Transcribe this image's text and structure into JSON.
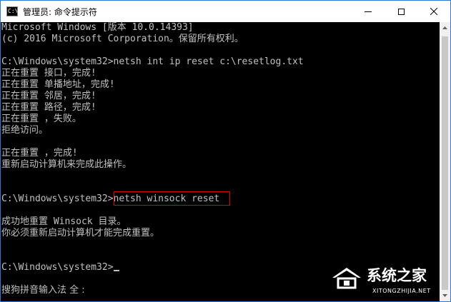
{
  "window": {
    "title": "管理员: 命令提示符",
    "icon_text": "C:\\"
  },
  "console": {
    "lines": [
      "Microsoft Windows [版本 10.0.14393]",
      "(c) 2016 Microsoft Corporation。保留所有权利。",
      "",
      "C:\\Windows\\system32>netsh int ip reset c:\\resetlog.txt",
      "正在重置 接口，完成!",
      "正在重置 单播地址，完成!",
      "正在重置 邻居，完成!",
      "正在重置 路径，完成!",
      "正在重置 ，失败。",
      "拒绝访问。",
      "",
      "正在重置 ，完成!",
      "重新启动计算机来完成此操作。",
      "",
      "",
      "C:\\Windows\\system32>netsh winsock reset",
      "",
      "成功地重置 Winsock 目录。",
      "你必须重新启动计算机才能完成重置。",
      "",
      "",
      "C:\\Windows\\system32>"
    ],
    "ime_status": "搜狗拼音输入法 全 :"
  },
  "watermark": {
    "name": "系统之家",
    "url": "XITONGZHIJIA.NET"
  },
  "icons": {
    "app": "console-icon",
    "minimize": "minimize-icon",
    "maximize": "maximize-icon",
    "close": "close-icon",
    "scroll_up": "chevron-up-icon",
    "scroll_down": "chevron-down-icon"
  },
  "colors": {
    "console_bg": "#000000",
    "console_text": "#c0c0c0",
    "highlight_border": "#e00000",
    "window_border": "#2b79d6"
  }
}
